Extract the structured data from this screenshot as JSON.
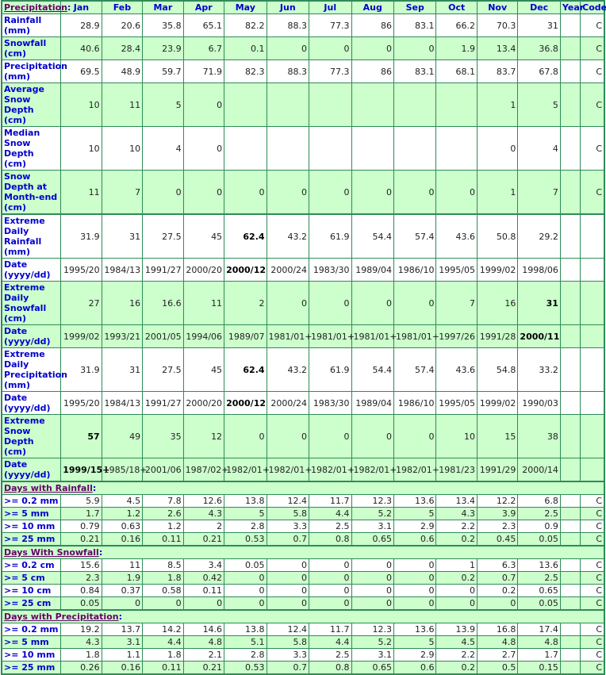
{
  "header": {
    "section_title": "Precipitation",
    "months": [
      "Jan",
      "Feb",
      "Mar",
      "Apr",
      "May",
      "Jun",
      "Jul",
      "Aug",
      "Sep",
      "Oct",
      "Nov",
      "Dec"
    ],
    "year_label": "Year",
    "code_label": "Code"
  },
  "colors": {
    "border": "#2e8b57",
    "shaded_row": "#ccffcc",
    "label_text": "#0000cc",
    "section_title": "#660066"
  },
  "main_rows": [
    {
      "label": "Rainfall (mm)",
      "values": [
        "28.9",
        "20.6",
        "35.8",
        "65.1",
        "82.2",
        "88.3",
        "77.3",
        "86",
        "83.1",
        "66.2",
        "70.3",
        "31"
      ],
      "year": "",
      "code": "C",
      "shade": "w"
    },
    {
      "label": "Snowfall (cm)",
      "values": [
        "40.6",
        "28.4",
        "23.9",
        "6.7",
        "0.1",
        "0",
        "0",
        "0",
        "0",
        "1.9",
        "13.4",
        "36.8"
      ],
      "year": "",
      "code": "C",
      "shade": "g"
    },
    {
      "label": "Precipitation (mm)",
      "values": [
        "69.5",
        "48.9",
        "59.7",
        "71.9",
        "82.3",
        "88.3",
        "77.3",
        "86",
        "83.1",
        "68.1",
        "83.7",
        "67.8"
      ],
      "year": "",
      "code": "C",
      "shade": "w"
    },
    {
      "label": "Average Snow Depth (cm)",
      "values": [
        "10",
        "11",
        "5",
        "0",
        "",
        "",
        "",
        "",
        "",
        "",
        "1",
        "5"
      ],
      "year": "",
      "code": "C",
      "shade": "g"
    },
    {
      "label": "Median Snow Depth (cm)",
      "values": [
        "10",
        "10",
        "4",
        "0",
        "",
        "",
        "",
        "",
        "",
        "",
        "0",
        "4"
      ],
      "year": "",
      "code": "C",
      "shade": "w"
    },
    {
      "label": "Snow Depth at Month-end (cm)",
      "values": [
        "11",
        "7",
        "0",
        "0",
        "0",
        "0",
        "0",
        "0",
        "0",
        "0",
        "1",
        "7"
      ],
      "year": "",
      "code": "C",
      "shade": "g"
    }
  ],
  "extreme_rows": [
    {
      "label": "Extreme Daily Rainfall (mm)",
      "values": [
        "31.9",
        "31",
        "27.5",
        "45",
        "62.4",
        "43.2",
        "61.9",
        "54.4",
        "57.4",
        "43.6",
        "50.8",
        "29.2"
      ],
      "bold_index": 4,
      "shade": "w"
    },
    {
      "label": "Date (yyyy/dd)",
      "values": [
        "1995/20",
        "1984/13",
        "1991/27",
        "2000/20",
        "2000/12",
        "2000/24",
        "1983/30",
        "1989/04",
        "1986/10",
        "1995/05",
        "1999/02",
        "1998/06"
      ],
      "bold_index": 4,
      "shade": "w"
    },
    {
      "label": "Extreme Daily Snowfall (cm)",
      "values": [
        "27",
        "16",
        "16.6",
        "11",
        "2",
        "0",
        "0",
        "0",
        "0",
        "7",
        "16",
        "31"
      ],
      "bold_index": 11,
      "shade": "g"
    },
    {
      "label": "Date (yyyy/dd)",
      "values": [
        "1999/02",
        "1993/21",
        "2001/05",
        "1994/06",
        "1989/07",
        "1981/01+",
        "1981/01+",
        "1981/01+",
        "1981/01+",
        "1997/26",
        "1991/28",
        "2000/11"
      ],
      "bold_index": 11,
      "shade": "g"
    },
    {
      "label": "Extreme Daily Precipitation (mm)",
      "values": [
        "31.9",
        "31",
        "27.5",
        "45",
        "62.4",
        "43.2",
        "61.9",
        "54.4",
        "57.4",
        "43.6",
        "54.8",
        "33.2"
      ],
      "bold_index": 4,
      "shade": "w"
    },
    {
      "label": "Date (yyyy/dd)",
      "values": [
        "1995/20",
        "1984/13",
        "1991/27",
        "2000/20",
        "2000/12",
        "2000/24",
        "1983/30",
        "1989/04",
        "1986/10",
        "1995/05",
        "1999/02",
        "1990/03"
      ],
      "bold_index": 4,
      "shade": "w"
    },
    {
      "label": "Extreme Snow Depth (cm)",
      "values": [
        "57",
        "49",
        "35",
        "12",
        "0",
        "0",
        "0",
        "0",
        "0",
        "10",
        "15",
        "38"
      ],
      "bold_index": 0,
      "shade": "g"
    },
    {
      "label": "Date (yyyy/dd)",
      "values": [
        "1999/15+",
        "1985/18+",
        "2001/06",
        "1987/02+",
        "1982/01+",
        "1982/01+",
        "1982/01+",
        "1982/01+",
        "1982/01+",
        "1981/23",
        "1991/29",
        "2000/14"
      ],
      "bold_index": 0,
      "shade": "g"
    }
  ],
  "day_sections": [
    {
      "title": "Days with Rainfall",
      "rows": [
        {
          "label": ">= 0.2 mm",
          "values": [
            "5.9",
            "4.5",
            "7.8",
            "12.6",
            "13.8",
            "12.4",
            "11.7",
            "12.3",
            "13.6",
            "13.4",
            "12.2",
            "6.8"
          ],
          "code": "C"
        },
        {
          "label": ">= 5 mm",
          "values": [
            "1.7",
            "1.2",
            "2.6",
            "4.3",
            "5",
            "5.8",
            "4.4",
            "5.2",
            "5",
            "4.3",
            "3.9",
            "2.5"
          ],
          "code": "C"
        },
        {
          "label": ">= 10 mm",
          "values": [
            "0.79",
            "0.63",
            "1.2",
            "2",
            "2.8",
            "3.3",
            "2.5",
            "3.1",
            "2.9",
            "2.2",
            "2.3",
            "0.9"
          ],
          "code": "C"
        },
        {
          "label": ">= 25 mm",
          "values": [
            "0.21",
            "0.16",
            "0.11",
            "0.21",
            "0.53",
            "0.7",
            "0.8",
            "0.65",
            "0.6",
            "0.2",
            "0.45",
            "0.05"
          ],
          "code": "C"
        }
      ]
    },
    {
      "title": "Days With Snowfall",
      "rows": [
        {
          "label": ">= 0.2 cm",
          "values": [
            "15.6",
            "11",
            "8.5",
            "3.4",
            "0.05",
            "0",
            "0",
            "0",
            "0",
            "1",
            "6.3",
            "13.6"
          ],
          "code": "C"
        },
        {
          "label": ">= 5 cm",
          "values": [
            "2.3",
            "1.9",
            "1.8",
            "0.42",
            "0",
            "0",
            "0",
            "0",
            "0",
            "0.2",
            "0.7",
            "2.5"
          ],
          "code": "C"
        },
        {
          "label": ">= 10 cm",
          "values": [
            "0.84",
            "0.37",
            "0.58",
            "0.11",
            "0",
            "0",
            "0",
            "0",
            "0",
            "0",
            "0.2",
            "0.65"
          ],
          "code": "C"
        },
        {
          "label": ">= 25 cm",
          "values": [
            "0.05",
            "0",
            "0",
            "0",
            "0",
            "0",
            "0",
            "0",
            "0",
            "0",
            "0",
            "0.05"
          ],
          "code": "C"
        }
      ]
    },
    {
      "title": "Days with Precipitation",
      "rows": [
        {
          "label": ">= 0.2 mm",
          "values": [
            "19.2",
            "13.7",
            "14.2",
            "14.6",
            "13.8",
            "12.4",
            "11.7",
            "12.3",
            "13.6",
            "13.9",
            "16.8",
            "17.4"
          ],
          "code": "C"
        },
        {
          "label": ">= 5 mm",
          "values": [
            "4.3",
            "3.1",
            "4.4",
            "4.8",
            "5.1",
            "5.8",
            "4.4",
            "5.2",
            "5",
            "4.5",
            "4.8",
            "4.8"
          ],
          "code": "C"
        },
        {
          "label": ">= 10 mm",
          "values": [
            "1.8",
            "1.1",
            "1.8",
            "2.1",
            "2.8",
            "3.3",
            "2.5",
            "3.1",
            "2.9",
            "2.2",
            "2.7",
            "1.7"
          ],
          "code": "C"
        },
        {
          "label": ">= 25 mm",
          "values": [
            "0.26",
            "0.16",
            "0.11",
            "0.21",
            "0.53",
            "0.7",
            "0.8",
            "0.65",
            "0.6",
            "0.2",
            "0.5",
            "0.15"
          ],
          "code": "C"
        }
      ]
    }
  ]
}
